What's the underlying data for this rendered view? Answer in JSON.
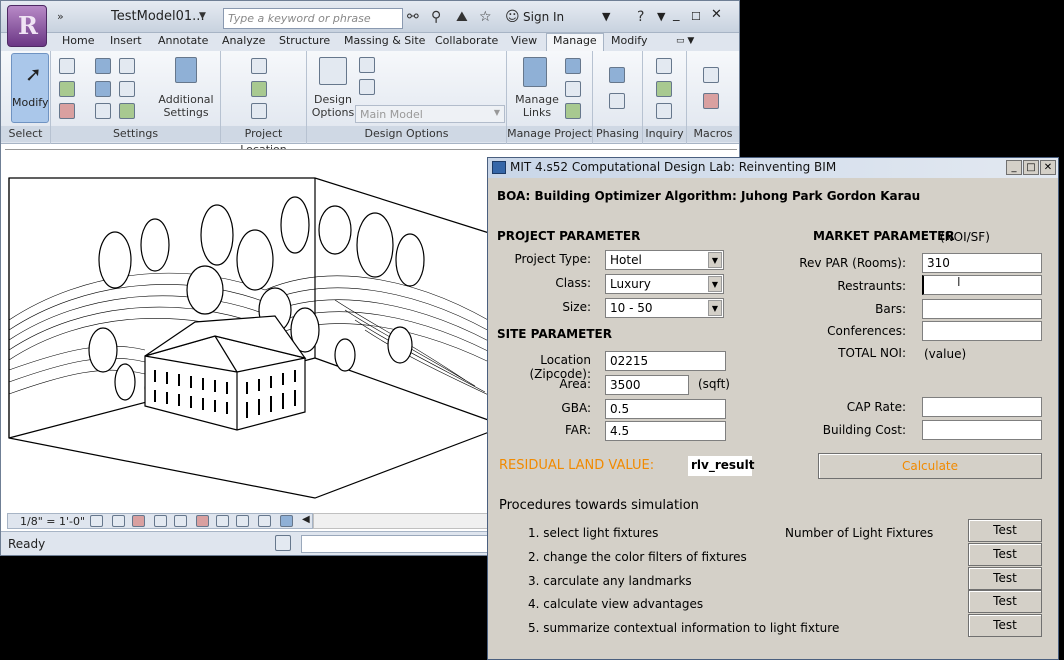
{
  "revit": {
    "title": "TestModel01...",
    "search_placeholder": "Type a keyword or phrase",
    "sign_in": "Sign In",
    "tabs": [
      "Home",
      "Insert",
      "Annotate",
      "Analyze",
      "Structure",
      "Massing & Site",
      "Collaborate",
      "View",
      "Manage",
      "Modify"
    ],
    "active_tab": "Manage",
    "panels": {
      "select": "Select",
      "settings": "Settings",
      "project_location": "Project Location",
      "design_options": "Design Options",
      "manage_project": "Manage Project",
      "phasing": "Phasing",
      "inquiry": "Inquiry",
      "macros": "Macros"
    },
    "buttons": {
      "modify": "Modify",
      "additional_settings": "Additional Settings",
      "design_options": "Design Options",
      "manage_links": "Manage Links"
    },
    "main_model": "Main Model",
    "scale": "1/8\" = 1'-0\"",
    "status": "Ready"
  },
  "dialog": {
    "title": "MIT 4.s52 Computational Design Lab: Reinventing BIM",
    "subtitle": "BOA: Building Optimizer Algorithm: Juhong Park  Gordon Karau",
    "project_header": "PROJECT PARAMETER",
    "project_type_label": "Project Type:",
    "project_type_value": "Hotel",
    "class_label": "Class:",
    "class_value": "Luxury",
    "size_label": "Size:",
    "size_value": "10 - 50",
    "site_header": "SITE PARAMETER",
    "location_label": "Location (Zipcode):",
    "location_value": "02215",
    "area_label": "Area:",
    "area_value": "3500",
    "area_unit": "(sqft)",
    "gba_label": "GBA:",
    "gba_value": "0.5",
    "far_label": "FAR:",
    "far_value": "4.5",
    "market_header": "MARKET PARAMETER",
    "market_unit": "(NOI/SF)",
    "revpar_label": "Rev PAR (Rooms):",
    "revpar_value": "310",
    "restraunts_label": "Restraunts:",
    "restraunts_value": "",
    "bars_label": "Bars:",
    "bars_value": "",
    "conferences_label": "Conferences:",
    "conferences_value": "",
    "total_noi_label": "TOTAL NOI:",
    "total_noi_value": "(value)",
    "cap_rate_label": "CAP Rate:",
    "cap_rate_value": "",
    "building_cost_label": "Building Cost:",
    "building_cost_value": "",
    "rlv_label": "RESIDUAL LAND VALUE:",
    "rlv_value": "rlv_result",
    "calculate": "Calculate",
    "procedures_header": "Procedures towards simulation",
    "light_fixtures_label": "Number of Light Fixtures",
    "procedures": [
      "1.  select light fixtures",
      "2.  change the color filters of fixtures",
      "3.  carculate any landmarks",
      "4.  calculate view advantages",
      "5.  summarize  contextual information   to light fixture"
    ],
    "test_label": "Test"
  },
  "colors": {
    "accent_orange": "#f18a00",
    "titlebar": "#c9d6e8",
    "dialog_bg": "#d4d0c8"
  }
}
